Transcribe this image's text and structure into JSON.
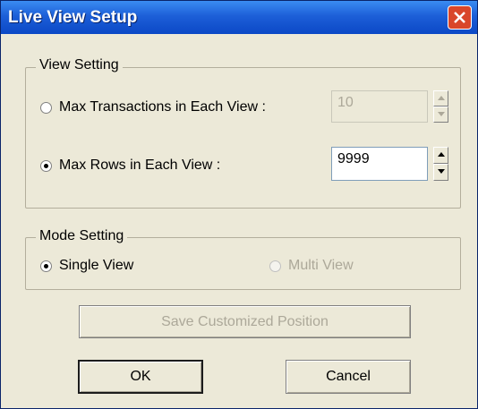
{
  "window": {
    "title": "Live View Setup"
  },
  "view_setting": {
    "legend": "View Setting",
    "max_transactions": {
      "label": "Max Transactions in Each View :",
      "value": "10",
      "selected": false,
      "enabled": false
    },
    "max_rows": {
      "label": "Max Rows in Each View :",
      "value": "9999",
      "selected": true,
      "enabled": true
    }
  },
  "mode_setting": {
    "legend": "Mode Setting",
    "single_view": {
      "label": "Single View",
      "selected": true,
      "enabled": true
    },
    "multi_view": {
      "label": "Multi View",
      "selected": false,
      "enabled": false
    }
  },
  "buttons": {
    "save_position": "Save Customized Position",
    "ok": "OK",
    "cancel": "Cancel"
  }
}
